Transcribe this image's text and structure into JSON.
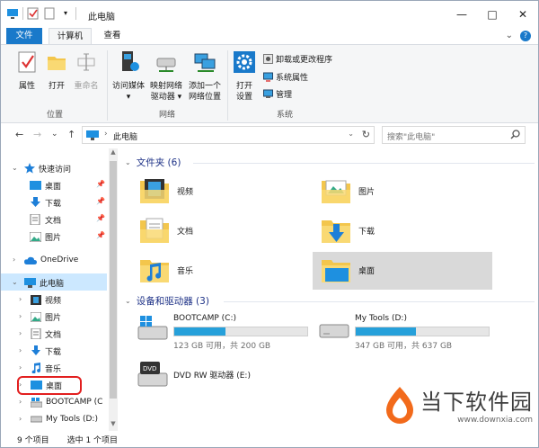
{
  "window": {
    "title": "此电脑",
    "minimize": "—",
    "maximize": "□",
    "close": "✕"
  },
  "ribbon_tabs": {
    "file": "文件",
    "computer": "计算机",
    "view": "查看",
    "expand": "⌄",
    "help": "?"
  },
  "ribbon": {
    "location": {
      "label": "位置",
      "items": [
        "属性",
        "打开",
        "重命名"
      ]
    },
    "network": {
      "label": "网络",
      "access_media": [
        "访问媒体",
        "▾"
      ],
      "map_drive": [
        "映射网络",
        "驱动器 ▾"
      ],
      "add_location": [
        "添加一个",
        "网络位置"
      ]
    },
    "system": {
      "label": "系统",
      "open_settings": [
        "打开",
        "设置"
      ],
      "uninstall": "卸载或更改程序",
      "properties": "系统属性",
      "manage": "管理"
    }
  },
  "address_bar": {
    "back": "←",
    "forward": "→",
    "dropdown": "⌄",
    "up": "↑",
    "path": "此电脑",
    "chevron": "›",
    "refresh": "↻",
    "search_placeholder": "搜索\"此电脑\""
  },
  "nav_pane": {
    "quick_access": "快速访问",
    "quick_items": [
      "桌面",
      "下载",
      "文档",
      "图片"
    ],
    "onedrive": "OneDrive",
    "this_pc": "此电脑",
    "pc_items": [
      "视频",
      "图片",
      "文档",
      "下载",
      "音乐",
      "桌面"
    ],
    "drives": [
      "BOOTCAMP (C",
      "My Tools (D:)"
    ],
    "pin": "📌"
  },
  "content": {
    "folders_header": "文件夹 (6)",
    "folders": [
      "视频",
      "图片",
      "文档",
      "下载",
      "音乐",
      "桌面"
    ],
    "devices_header": "设备和驱动器 (3)",
    "drives": [
      {
        "name": "BOOTCAMP (C:)",
        "info": "123 GB 可用，共 200 GB",
        "used_fraction": 0.385
      },
      {
        "name": "My Tools (D:)",
        "info": "347 GB 可用，共 637 GB",
        "used_fraction": 0.455
      },
      {
        "name": "DVD RW 驱动器 (E:)",
        "info": ""
      }
    ]
  },
  "status_bar": {
    "count": "9 个项目",
    "selected": "选中 1 个项目"
  },
  "watermark": {
    "title": "当下软件园",
    "url": "www.downxia.com"
  }
}
